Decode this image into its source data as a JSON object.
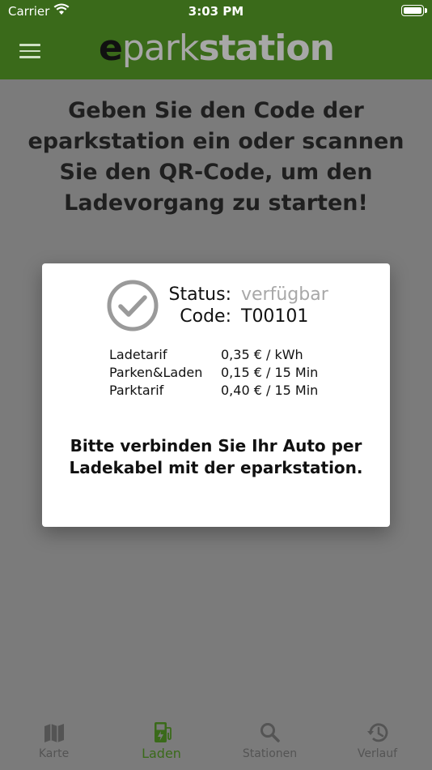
{
  "status_bar": {
    "carrier": "Carrier",
    "time": "3:03 PM"
  },
  "header": {
    "logo_e": "e",
    "logo_park": "park",
    "logo_station": "station",
    "brand_color": "#3a6a1a"
  },
  "headline": "Geben Sie den Code der eparkstation ein oder scannen Sie den QR-Code, um den Ladevorgang zu starten!",
  "modal": {
    "status_label": "Status:",
    "status_value": "verfügbar",
    "code_label": "Code:",
    "code_value": "T00101",
    "tariffs": [
      {
        "name": "Ladetarif",
        "price": "0,35 € / kWh"
      },
      {
        "name": "Parken&Laden",
        "price": "0,15 € / 15 Min"
      },
      {
        "name": "Parktarif",
        "price": "0,40 € / 15 Min"
      }
    ],
    "message": "Bitte verbinden Sie Ihr Auto per Ladekabel mit der eparkstation."
  },
  "tabs": [
    {
      "label": "Karte",
      "icon": "map-icon"
    },
    {
      "label": "Laden",
      "icon": "charging-icon",
      "active": true
    },
    {
      "label": "Stationen",
      "icon": "search-icon"
    },
    {
      "label": "Verlauf",
      "icon": "history-icon"
    }
  ]
}
